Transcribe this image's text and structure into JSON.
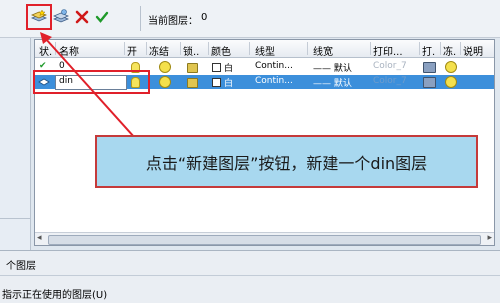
{
  "toolbar": {
    "current_layer_label": "当前图层：",
    "current_layer_value": "0",
    "icons": [
      "new-layer-icon",
      "delete-layer-icon",
      "cancel-icon",
      "set-current-icon"
    ]
  },
  "columns": [
    "状.",
    "名称",
    "开",
    "冻结",
    "锁..",
    "颜色",
    "线型",
    "线宽",
    "打印...",
    "打.",
    "冻.",
    "说明"
  ],
  "rows": [
    {
      "status": "✔",
      "name": "0",
      "color": "白",
      "linetype": "Contin...",
      "lineweight": "—— 默认",
      "plotstyle": "Color_7",
      "selected": false
    },
    {
      "status": "◆",
      "name": "din",
      "color": "白",
      "linetype": "Contin...",
      "lineweight": "—— 默认",
      "plotstyle": "Color_7",
      "selected": true
    }
  ],
  "callout": {
    "text": "点击“新建图层”按钮，新建一个din图层"
  },
  "status": {
    "line1": "个图层",
    "line2": "指示正在使用的图层(U)"
  },
  "colors": {
    "annotation_red": "#e0202a",
    "selection_blue": "#3c8fdb",
    "callout_fill": "#a8d8ef"
  }
}
